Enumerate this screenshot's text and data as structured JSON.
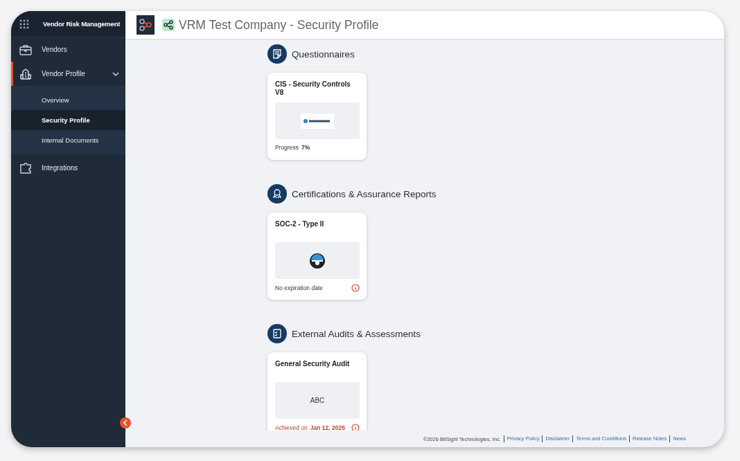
{
  "sidebar": {
    "title": "Vendor Risk Management",
    "items": [
      {
        "label": "Vendors",
        "kind": "briefcase",
        "selected": false
      },
      {
        "label": "Vendor Profile",
        "kind": "building",
        "selected": true,
        "expanded": true,
        "children": [
          {
            "label": "Overview",
            "selected": false
          },
          {
            "label": "Security Profile",
            "selected": true
          },
          {
            "label": "Internal Documents",
            "selected": false
          }
        ]
      },
      {
        "label": "Integrations",
        "kind": "puzzle",
        "selected": false
      }
    ]
  },
  "header": {
    "title": "VRM Test Company - Security Profile"
  },
  "sections": [
    {
      "title": "Questionnaires",
      "kind": "questionnaire",
      "card": {
        "title": "CIS - Security Controls V8",
        "image": {
          "kind": "cis"
        },
        "footer": {
          "kind": "progress",
          "label": "Progress",
          "value": "7%"
        }
      }
    },
    {
      "title": "Certifications & Assurance Reports",
      "kind": "certificate",
      "card": {
        "title": "SOC-2 - Type II",
        "image": {
          "kind": "soc"
        },
        "footer": {
          "kind": "warning",
          "label": "No expiration date"
        }
      }
    },
    {
      "title": "External Audits & Assessments",
      "kind": "audit",
      "card": {
        "title": "General Security Audit",
        "image": {
          "kind": "text",
          "text": "ABC"
        },
        "footer": {
          "kind": "achieved",
          "label": "Achieved on",
          "value": "Jan 12, 2025"
        }
      }
    }
  ],
  "footer": {
    "copyright": "©2026 BitSight Technologies, Inc.",
    "links": [
      "Privacy Policy",
      "Disclaimer",
      "Terms and Conditions",
      "Release Notes",
      "News"
    ]
  }
}
